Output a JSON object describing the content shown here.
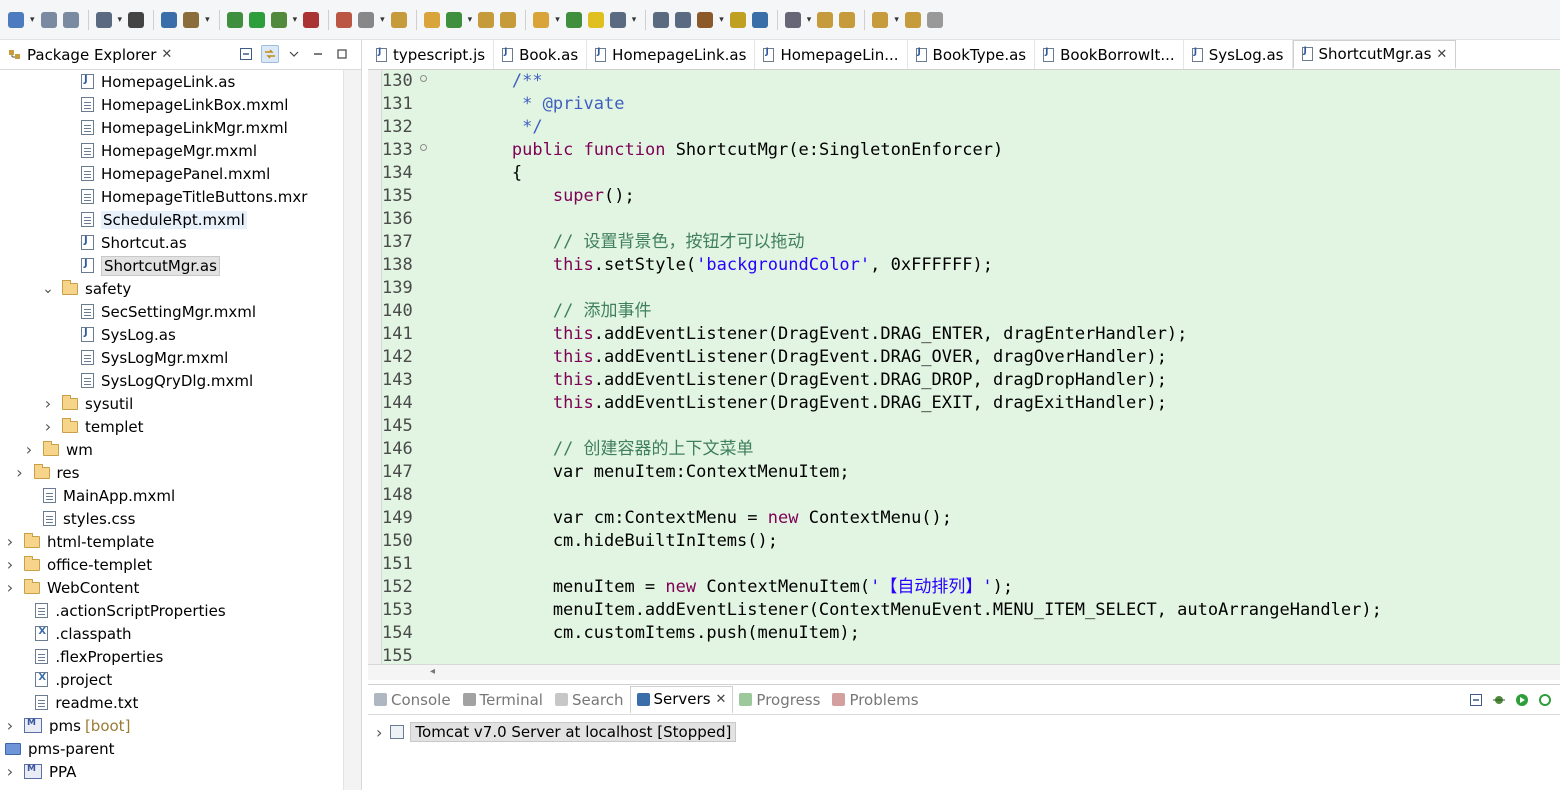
{
  "toolbar": {
    "icons": [
      "new-icon",
      "save-icon",
      "save-all-icon",
      "binary-icon",
      "profile-icon",
      "screen-icon",
      "skip-breakpoints-icon",
      "debug-icon",
      "run-icon",
      "run-external-icon",
      "run-coverage-icon",
      "stop-icon",
      "external-tools-icon",
      "new-package-icon",
      "new-class-icon",
      "refresh-icon",
      "open-type-icon",
      "build-icon",
      "open-folder-icon",
      "lightbulb-icon",
      "highlight-icon",
      "toggle-mark-icon",
      "block-selection-icon",
      "show-whitespace-icon",
      "plugin-icon",
      "help-icon",
      "globe-icon",
      "pin-icon",
      "next-annotation-icon",
      "prev-annotation-icon",
      "last-edit-icon",
      "back-icon",
      "forward-icon"
    ]
  },
  "package_explorer": {
    "title": "Package Explorer",
    "close": "✕",
    "items": [
      {
        "label": "HomepageLink.as",
        "icon": "as",
        "level": 3
      },
      {
        "label": "HomepageLinkBox.mxml",
        "icon": "file",
        "level": 3
      },
      {
        "label": "HomepageLinkMgr.mxml",
        "icon": "file",
        "level": 3
      },
      {
        "label": "HomepageMgr.mxml",
        "icon": "file",
        "level": 3
      },
      {
        "label": "HomepagePanel.mxml",
        "icon": "file",
        "level": 3
      },
      {
        "label": "HomepageTitleButtons.mxr",
        "icon": "file",
        "level": 3
      },
      {
        "label": "ScheduleRpt.mxml",
        "icon": "file",
        "level": 3,
        "state": "hovered"
      },
      {
        "label": "Shortcut.as",
        "icon": "as",
        "level": 3
      },
      {
        "label": "ShortcutMgr.as",
        "icon": "as",
        "level": 3,
        "state": "selected"
      },
      {
        "label": "safety",
        "icon": "folder",
        "level": 2,
        "arrow": "expanded"
      },
      {
        "label": "SecSettingMgr.mxml",
        "icon": "file",
        "level": 3
      },
      {
        "label": "SysLog.as",
        "icon": "as",
        "level": 3
      },
      {
        "label": "SysLogMgr.mxml",
        "icon": "file",
        "level": 3
      },
      {
        "label": "SysLogQryDlg.mxml",
        "icon": "file",
        "level": 3
      },
      {
        "label": "sysutil",
        "icon": "folder",
        "level": 2,
        "arrow": "collapsed"
      },
      {
        "label": "templet",
        "icon": "folder",
        "level": 2,
        "arrow": "collapsed"
      },
      {
        "label": "wm",
        "icon": "folder",
        "level": 1,
        "arrow": "collapsed"
      },
      {
        "label": "res",
        "icon": "folder",
        "level": 0.5,
        "arrow": "collapsed"
      },
      {
        "label": "MainApp.mxml",
        "icon": "file",
        "level": 1
      },
      {
        "label": "styles.css",
        "icon": "file",
        "level": 1
      },
      {
        "label": "html-template",
        "icon": "folder",
        "level": 0,
        "arrow": "collapsed"
      },
      {
        "label": "office-templet",
        "icon": "folder",
        "level": 0,
        "arrow": "collapsed"
      },
      {
        "label": "WebContent",
        "icon": "folder",
        "level": 0,
        "arrow": "collapsed"
      },
      {
        "label": ".actionScriptProperties",
        "icon": "file",
        "level": 0.6
      },
      {
        "label": ".classpath",
        "icon": "x",
        "level": 0.6
      },
      {
        "label": ".flexProperties",
        "icon": "file",
        "level": 0.6
      },
      {
        "label": ".project",
        "icon": "x",
        "level": 0.6
      },
      {
        "label": "readme.txt",
        "icon": "file",
        "level": 0.6
      },
      {
        "label": "pms",
        "icon": "proj",
        "level": -1,
        "arrow": "collapsed",
        "suffix": "[boot]"
      },
      {
        "label": "pms-parent",
        "icon": "projfolder",
        "level": -1
      },
      {
        "label": "PPA",
        "icon": "proj",
        "level": -1,
        "arrow": "collapsed"
      }
    ]
  },
  "editor": {
    "tabs": [
      {
        "label": "typescript.js"
      },
      {
        "label": "Book.as"
      },
      {
        "label": "HomepageLink.as"
      },
      {
        "label": "HomepageLin..."
      },
      {
        "label": "BookType.as"
      },
      {
        "label": "BookBorrowIt..."
      },
      {
        "label": "SysLog.as"
      },
      {
        "label": "ShortcutMgr.as",
        "active": true,
        "close": "✕"
      }
    ],
    "lines": [
      {
        "n": "130",
        "fold": true,
        "segs": [
          {
            "t": "        "
          },
          {
            "t": "/**",
            "c": "doc"
          }
        ]
      },
      {
        "n": "131",
        "segs": [
          {
            "t": "         "
          },
          {
            "t": "* @private",
            "c": "doc"
          }
        ]
      },
      {
        "n": "132",
        "segs": [
          {
            "t": "         "
          },
          {
            "t": "*/",
            "c": "doc"
          }
        ]
      },
      {
        "n": "133",
        "fold": true,
        "segs": [
          {
            "t": "        "
          },
          {
            "t": "public",
            "c": "kw"
          },
          {
            "t": " "
          },
          {
            "t": "function",
            "c": "kw"
          },
          {
            "t": " ShortcutMgr(e:SingletonEnforcer)"
          }
        ]
      },
      {
        "n": "134",
        "segs": [
          {
            "t": "        {"
          }
        ]
      },
      {
        "n": "135",
        "segs": [
          {
            "t": "            "
          },
          {
            "t": "super",
            "c": "kw"
          },
          {
            "t": "();"
          }
        ]
      },
      {
        "n": "136",
        "segs": [
          {
            "t": ""
          }
        ]
      },
      {
        "n": "137",
        "segs": [
          {
            "t": "            "
          },
          {
            "t": "// 设置背景色，按钮才可以拖动",
            "c": "cm"
          }
        ]
      },
      {
        "n": "138",
        "segs": [
          {
            "t": "            "
          },
          {
            "t": "this",
            "c": "kw"
          },
          {
            "t": ".setStyle("
          },
          {
            "t": "'backgroundColor'",
            "c": "str"
          },
          {
            "t": ", 0xFFFFFF);"
          }
        ]
      },
      {
        "n": "139",
        "segs": [
          {
            "t": ""
          }
        ]
      },
      {
        "n": "140",
        "segs": [
          {
            "t": "            "
          },
          {
            "t": "// 添加事件",
            "c": "cm"
          }
        ]
      },
      {
        "n": "141",
        "segs": [
          {
            "t": "            "
          },
          {
            "t": "this",
            "c": "kw"
          },
          {
            "t": ".addEventListener(DragEvent.DRAG_ENTER, dragEnterHandler);"
          }
        ]
      },
      {
        "n": "142",
        "segs": [
          {
            "t": "            "
          },
          {
            "t": "this",
            "c": "kw"
          },
          {
            "t": ".addEventListener(DragEvent.DRAG_OVER, dragOverHandler);"
          }
        ]
      },
      {
        "n": "143",
        "segs": [
          {
            "t": "            "
          },
          {
            "t": "this",
            "c": "kw"
          },
          {
            "t": ".addEventListener(DragEvent.DRAG_DROP, dragDropHandler);"
          }
        ]
      },
      {
        "n": "144",
        "segs": [
          {
            "t": "            "
          },
          {
            "t": "this",
            "c": "kw"
          },
          {
            "t": ".addEventListener(DragEvent.DRAG_EXIT, dragExitHandler);"
          }
        ]
      },
      {
        "n": "145",
        "segs": [
          {
            "t": ""
          }
        ]
      },
      {
        "n": "146",
        "segs": [
          {
            "t": "            "
          },
          {
            "t": "// 创建容器的上下文菜单",
            "c": "cm"
          }
        ]
      },
      {
        "n": "147",
        "segs": [
          {
            "t": "            var menuItem:ContextMenuItem;"
          }
        ]
      },
      {
        "n": "148",
        "segs": [
          {
            "t": ""
          }
        ]
      },
      {
        "n": "149",
        "segs": [
          {
            "t": "            var cm:ContextMenu = "
          },
          {
            "t": "new",
            "c": "kw"
          },
          {
            "t": " ContextMenu();"
          }
        ]
      },
      {
        "n": "150",
        "segs": [
          {
            "t": "            cm.hideBuiltInItems();"
          }
        ]
      },
      {
        "n": "151",
        "segs": [
          {
            "t": ""
          }
        ]
      },
      {
        "n": "152",
        "segs": [
          {
            "t": "            menuItem = "
          },
          {
            "t": "new",
            "c": "kw"
          },
          {
            "t": " ContextMenuItem("
          },
          {
            "t": "'【自动排列】'",
            "c": "str"
          },
          {
            "t": ");"
          }
        ]
      },
      {
        "n": "153",
        "segs": [
          {
            "t": "            menuItem.addEventListener(ContextMenuEvent.MENU_ITEM_SELECT, autoArrangeHandler);"
          }
        ]
      },
      {
        "n": "154",
        "segs": [
          {
            "t": "            cm.customItems.push(menuItem);"
          }
        ]
      },
      {
        "n": "155",
        "segs": [
          {
            "t": ""
          }
        ]
      }
    ],
    "colors": {
      "background": "#e2f5e2",
      "keyword": "#7f0055",
      "doc": "#3f5fbf",
      "comment": "#3f7f5f",
      "string": "#2a00ff"
    }
  },
  "bottom": {
    "tabs": [
      {
        "label": "Console",
        "icon": "console-icon"
      },
      {
        "label": "Terminal",
        "icon": "terminal-icon"
      },
      {
        "label": "Search",
        "icon": "search-icon"
      },
      {
        "label": "Servers",
        "icon": "servers-icon",
        "active": true,
        "close": "✕"
      },
      {
        "label": "Progress",
        "icon": "progress-icon"
      },
      {
        "label": "Problems",
        "icon": "problems-icon"
      }
    ],
    "servers": [
      {
        "label": "Tomcat v7.0 Server at localhost  [Stopped]"
      }
    ]
  }
}
